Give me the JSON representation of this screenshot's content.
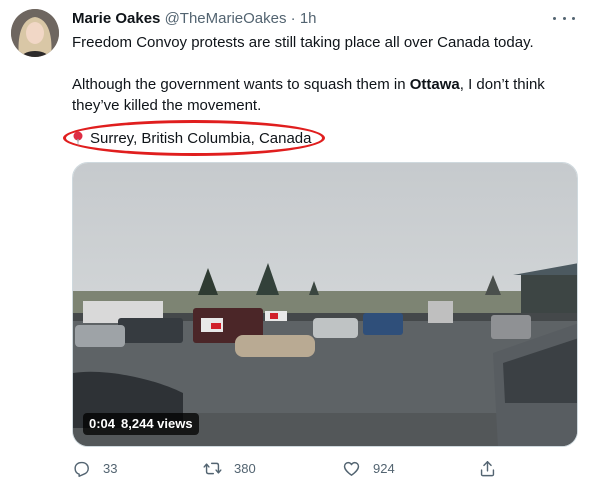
{
  "tweet": {
    "author_name": "Marie Oakes",
    "handle": "@TheMarieOakes",
    "dot": "·",
    "time": "1h",
    "line1": "Freedom Convoy protests are still taking place all over Canada today.",
    "line2_pre": "Although the government wants to squash them in ",
    "line2_bold": "Ottawa",
    "line2_post": ", I don’t think they’ve killed the movement.",
    "location": "Surrey, British Columbia, Canada"
  },
  "video": {
    "duration": "0:04",
    "views": "8,244 views"
  },
  "actions": {
    "reply_count": "33",
    "retweet_count": "380",
    "like_count": "924"
  },
  "colors": {
    "annotation_circle": "#e01e1e",
    "secondary_text": "#536471"
  },
  "icons": [
    "more-icon",
    "location-pin-icon",
    "reply-icon",
    "retweet-icon",
    "like-icon",
    "share-icon"
  ]
}
